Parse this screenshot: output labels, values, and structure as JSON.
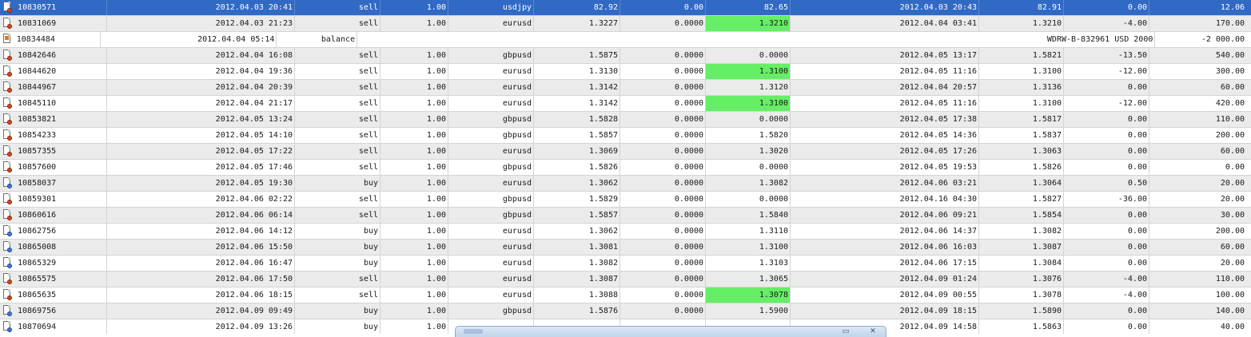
{
  "trades": [
    {
      "ticket": "10830571",
      "open_time": "2012.04.03 20:41",
      "type": "sell",
      "size": "1.00",
      "item": "usdjpy",
      "open_price": "82.92",
      "stop_loss": "0.00",
      "take_profit": "82.65",
      "close_time": "2012.04.03 20:43",
      "close_price": "82.91",
      "commission": "0.00",
      "profit": "12.06",
      "tp_highlight": false,
      "selected": true
    },
    {
      "ticket": "10831069",
      "open_time": "2012.04.03 21:23",
      "type": "sell",
      "size": "1.00",
      "item": "eurusd",
      "open_price": "1.3227",
      "stop_loss": "0.0000",
      "take_profit": "1.3210",
      "close_time": "2012.04.04 03:41",
      "close_price": "1.3210",
      "commission": "-4.00",
      "profit": "170.00",
      "tp_highlight": true
    },
    {
      "ticket": "10834484",
      "open_time": "2012.04.04 05:14",
      "type": "balance",
      "comment": "WDRW-B-832961 USD 2000",
      "profit": "-2 000.00"
    },
    {
      "ticket": "10842646",
      "open_time": "2012.04.04 16:08",
      "type": "sell",
      "size": "1.00",
      "item": "gbpusd",
      "open_price": "1.5875",
      "stop_loss": "0.0000",
      "take_profit": "0.0000",
      "close_time": "2012.04.05 13:17",
      "close_price": "1.5821",
      "commission": "-13.50",
      "profit": "540.00",
      "tp_highlight": false
    },
    {
      "ticket": "10844620",
      "open_time": "2012.04.04 19:36",
      "type": "sell",
      "size": "1.00",
      "item": "eurusd",
      "open_price": "1.3130",
      "stop_loss": "0.0000",
      "take_profit": "1.3100",
      "close_time": "2012.04.05 11:16",
      "close_price": "1.3100",
      "commission": "-12.00",
      "profit": "300.00",
      "tp_highlight": true
    },
    {
      "ticket": "10844967",
      "open_time": "2012.04.04 20:39",
      "type": "sell",
      "size": "1.00",
      "item": "eurusd",
      "open_price": "1.3142",
      "stop_loss": "0.0000",
      "take_profit": "1.3120",
      "close_time": "2012.04.04 20:57",
      "close_price": "1.3136",
      "commission": "0.00",
      "profit": "60.00",
      "tp_highlight": false
    },
    {
      "ticket": "10845110",
      "open_time": "2012.04.04 21:17",
      "type": "sell",
      "size": "1.00",
      "item": "eurusd",
      "open_price": "1.3142",
      "stop_loss": "0.0000",
      "take_profit": "1.3100",
      "close_time": "2012.04.05 11:16",
      "close_price": "1.3100",
      "commission": "-12.00",
      "profit": "420.00",
      "tp_highlight": true
    },
    {
      "ticket": "10853821",
      "open_time": "2012.04.05 13:24",
      "type": "sell",
      "size": "1.00",
      "item": "gbpusd",
      "open_price": "1.5828",
      "stop_loss": "0.0000",
      "take_profit": "0.0000",
      "close_time": "2012.04.05 17:38",
      "close_price": "1.5817",
      "commission": "0.00",
      "profit": "110.00",
      "tp_highlight": false
    },
    {
      "ticket": "10854233",
      "open_time": "2012.04.05 14:10",
      "type": "sell",
      "size": "1.00",
      "item": "gbpusd",
      "open_price": "1.5857",
      "stop_loss": "0.0000",
      "take_profit": "1.5820",
      "close_time": "2012.04.05 14:36",
      "close_price": "1.5837",
      "commission": "0.00",
      "profit": "200.00",
      "tp_highlight": false
    },
    {
      "ticket": "10857355",
      "open_time": "2012.04.05 17:22",
      "type": "sell",
      "size": "1.00",
      "item": "eurusd",
      "open_price": "1.3069",
      "stop_loss": "0.0000",
      "take_profit": "1.3020",
      "close_time": "2012.04.05 17:26",
      "close_price": "1.3063",
      "commission": "0.00",
      "profit": "60.00",
      "tp_highlight": false
    },
    {
      "ticket": "10857600",
      "open_time": "2012.04.05 17:46",
      "type": "sell",
      "size": "1.00",
      "item": "gbpusd",
      "open_price": "1.5826",
      "stop_loss": "0.0000",
      "take_profit": "0.0000",
      "close_time": "2012.04.05 19:53",
      "close_price": "1.5826",
      "commission": "0.00",
      "profit": "0.00",
      "tp_highlight": false
    },
    {
      "ticket": "10858037",
      "open_time": "2012.04.05 19:30",
      "type": "buy",
      "size": "1.00",
      "item": "eurusd",
      "open_price": "1.3062",
      "stop_loss": "0.0000",
      "take_profit": "1.3082",
      "close_time": "2012.04.06 03:21",
      "close_price": "1.3064",
      "commission": "0.50",
      "profit": "20.00",
      "tp_highlight": false
    },
    {
      "ticket": "10859301",
      "open_time": "2012.04.06 02:22",
      "type": "sell",
      "size": "1.00",
      "item": "gbpusd",
      "open_price": "1.5829",
      "stop_loss": "0.0000",
      "take_profit": "0.0000",
      "close_time": "2012.04.16 04:30",
      "close_price": "1.5827",
      "commission": "-36.00",
      "profit": "20.00",
      "tp_highlight": false
    },
    {
      "ticket": "10860616",
      "open_time": "2012.04.06 06:14",
      "type": "sell",
      "size": "1.00",
      "item": "gbpusd",
      "open_price": "1.5857",
      "stop_loss": "0.0000",
      "take_profit": "1.5840",
      "close_time": "2012.04.06 09:21",
      "close_price": "1.5854",
      "commission": "0.00",
      "profit": "30.00",
      "tp_highlight": false
    },
    {
      "ticket": "10862756",
      "open_time": "2012.04.06 14:12",
      "type": "buy",
      "size": "1.00",
      "item": "eurusd",
      "open_price": "1.3062",
      "stop_loss": "0.0000",
      "take_profit": "1.3110",
      "close_time": "2012.04.06 14:37",
      "close_price": "1.3082",
      "commission": "0.00",
      "profit": "200.00",
      "tp_highlight": false
    },
    {
      "ticket": "10865008",
      "open_time": "2012.04.06 15:50",
      "type": "buy",
      "size": "1.00",
      "item": "eurusd",
      "open_price": "1.3081",
      "stop_loss": "0.0000",
      "take_profit": "1.3100",
      "close_time": "2012.04.06 16:03",
      "close_price": "1.3087",
      "commission": "0.00",
      "profit": "60.00",
      "tp_highlight": false
    },
    {
      "ticket": "10865329",
      "open_time": "2012.04.06 16:47",
      "type": "buy",
      "size": "1.00",
      "item": "eurusd",
      "open_price": "1.3082",
      "stop_loss": "0.0000",
      "take_profit": "1.3103",
      "close_time": "2012.04.06 17:15",
      "close_price": "1.3084",
      "commission": "0.00",
      "profit": "20.00",
      "tp_highlight": false
    },
    {
      "ticket": "10865575",
      "open_time": "2012.04.06 17:50",
      "type": "sell",
      "size": "1.00",
      "item": "eurusd",
      "open_price": "1.3087",
      "stop_loss": "0.0000",
      "take_profit": "1.3065",
      "close_time": "2012.04.09 01:24",
      "close_price": "1.3076",
      "commission": "-4.00",
      "profit": "110.00",
      "tp_highlight": false
    },
    {
      "ticket": "10865635",
      "open_time": "2012.04.06 18:15",
      "type": "sell",
      "size": "1.00",
      "item": "eurusd",
      "open_price": "1.3088",
      "stop_loss": "0.0000",
      "take_profit": "1.3078",
      "close_time": "2012.04.09 00:55",
      "close_price": "1.3078",
      "commission": "-4.00",
      "profit": "100.00",
      "tp_highlight": true
    },
    {
      "ticket": "10869756",
      "open_time": "2012.04.09 09:49",
      "type": "buy",
      "size": "1.00",
      "item": "gbpusd",
      "open_price": "1.5876",
      "stop_loss": "0.0000",
      "take_profit": "1.5900",
      "close_time": "2012.04.09 18:15",
      "close_price": "1.5890",
      "commission": "0.00",
      "profit": "140.00",
      "tp_highlight": false
    },
    {
      "ticket": "10870694",
      "open_time": "2012.04.09 13:26",
      "type": "buy",
      "size": "1.00",
      "item": "",
      "open_price": "",
      "stop_loss": "",
      "take_profit": "",
      "close_time": "2012.04.09 14:58",
      "close_price": "1.5863",
      "commission": "0.00",
      "profit": "40.00",
      "tp_highlight": false
    }
  ],
  "colors": {
    "selected_row": "#316ac5",
    "take_profit_hit": "#66ee66",
    "alt_row": "#ebebeb",
    "sell_icon": "#d24a1a",
    "buy_icon": "#3a7ad8"
  },
  "icons": {
    "order": "order-document-icon",
    "balance": "balance-icon"
  },
  "window": {
    "minimize_glyph": "▭",
    "close_glyph": "✕"
  }
}
